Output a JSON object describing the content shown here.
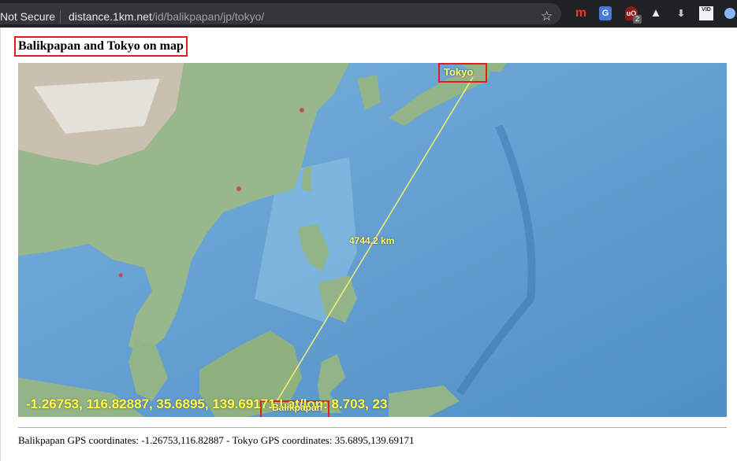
{
  "browser": {
    "security_label": "Not Secure",
    "url_host": "distance.1km.net",
    "url_path": "/id/balikpapan/jp/tokyo/",
    "bookmark_icon": "star-icon",
    "extensions": {
      "m_label": "m",
      "translate_label": "G",
      "ublock_label": "uO",
      "ublock_badge": "2",
      "alert_label": "▲",
      "download_label": "⬇",
      "video_label": "VID",
      "chrome_icon": "circle-icon"
    }
  },
  "page": {
    "heading": "Balikpapan and Tokyo on map",
    "map": {
      "tokyo_label": "Tokyo",
      "balikpapan_label": "Balikpapan",
      "distance_label": "4744.2 km",
      "coords_overlay": "-1.26753, 116.82887, 35.6895, 139.69171 Lat/lon: 8.703, 23"
    },
    "gps_line": "Balikpapan GPS coordinates: -1.26753,116.82887 - Tokyo GPS coordinates: 35.6895,139.69171"
  },
  "colors": {
    "highlight_red": "#e21d1d",
    "label_yellow": "#ffff66",
    "ocean": "#5d9bd0",
    "land": "#8fb58a"
  }
}
